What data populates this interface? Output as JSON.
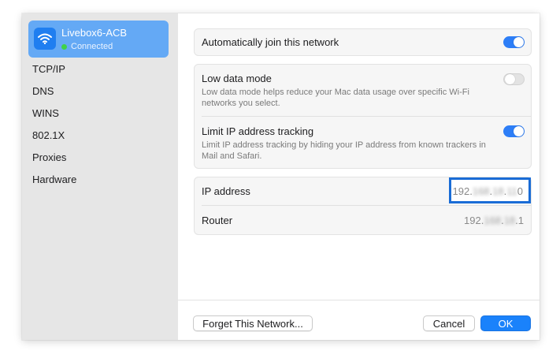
{
  "sidebar": {
    "network": {
      "name": "Livebox6-ACB",
      "status": "Connected",
      "icon": "wifi-icon"
    },
    "items": [
      {
        "label": "TCP/IP"
      },
      {
        "label": "DNS"
      },
      {
        "label": "WINS"
      },
      {
        "label": "802.1X"
      },
      {
        "label": "Proxies"
      },
      {
        "label": "Hardware"
      }
    ]
  },
  "settings": {
    "auto_join": {
      "label": "Automatically join this network",
      "enabled": true
    },
    "low_data": {
      "label": "Low data mode",
      "description": "Low data mode helps reduce your Mac data usage over specific Wi-Fi networks you select.",
      "enabled": false
    },
    "limit_ip": {
      "label": "Limit IP address tracking",
      "description": "Limit IP address tracking by hiding your IP address from known trackers in Mail and Safari.",
      "enabled": true
    }
  },
  "info": {
    "ip": {
      "label": "IP address",
      "prefix": "192.",
      "masked1": "168",
      "dot1": ".",
      "masked2": "18",
      "dot2": ".",
      "masked3": "11",
      "suffix": "0"
    },
    "router": {
      "label": "Router",
      "prefix": "192.",
      "masked1": "168",
      "dot1": ".",
      "masked2": "18",
      "suffix": ".1"
    }
  },
  "footer": {
    "forget_label": "Forget This Network...",
    "cancel_label": "Cancel",
    "ok_label": "OK"
  },
  "colors": {
    "accent": "#1a82fb",
    "toggle_on": "#2d7ef7",
    "highlight_border": "#1a6cd6",
    "connected_dot": "#3fd24a"
  }
}
